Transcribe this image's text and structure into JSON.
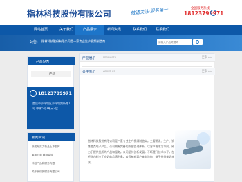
{
  "header": {
    "company_name": "指林科技股份有限公司",
    "slogan": "敬请关注·服务第一",
    "hotline_label": "全国服务热线",
    "hotline_number": "18123799971",
    "phone_icon": "phone-icon"
  },
  "nav": {
    "items": [
      "网站首页",
      "关于我们",
      "产品展示",
      "新闻资讯",
      "联系我们",
      "联系我们"
    ]
  },
  "banner": {
    "notice_label": "公告:",
    "notice_text": "指林科技股份有限公司是一家专业生产视频制造商...",
    "search_placeholder": "请输入产品关键词"
  },
  "sidebar": {
    "product_title": "产品分类",
    "product_item": "产品",
    "contact_phone": "18123799971",
    "contact_address": "重庆市沙坪坝区沙坪坝路新路1号 中建5号3单元2层",
    "news_title": "新闻资讯",
    "news_items": [
      "新发布实力新品上市发挥",
      "重要时刻 精准高效",
      "科技产品和服务有限",
      "关于我们的服务有限公司"
    ]
  },
  "content": {
    "products_title": "产品展示",
    "products_sub": "PRODUCTS",
    "about_title": "关于我们",
    "about_sub": "ABOUT US",
    "more": "更多 >>",
    "article": "指林科技股份有限公司是一家专业生产视频制造商。主要研发、生产、销售各类电子产品。公司拥有完善的质量管理体系，以客户需求为导向，致力于提供优质的产品和服务。公司坚持创新发展，不断提升技术水平，在行业内树立了良好的品牌形象。欢迎新老客户来电咨询，携手共创美好未来。"
  }
}
